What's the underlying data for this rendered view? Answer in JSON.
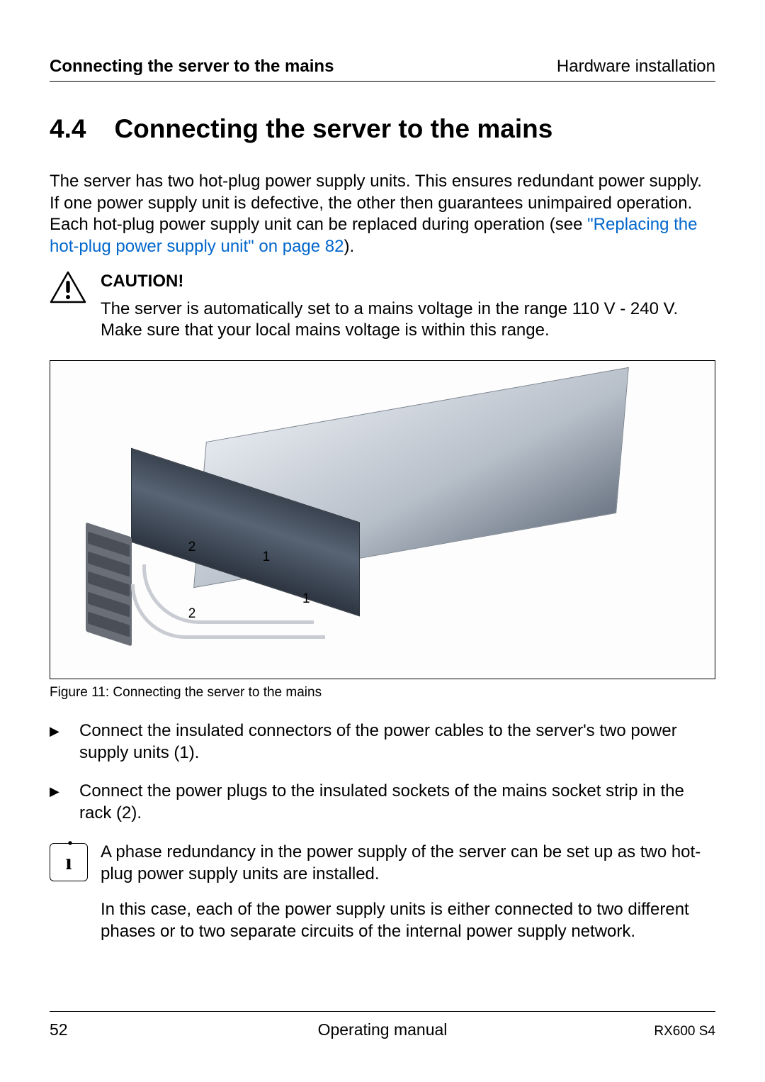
{
  "header": {
    "left": "Connecting the server to the mains",
    "right": "Hardware installation"
  },
  "section": {
    "number": "4.4",
    "title": "Connecting the server to the mains"
  },
  "intro": {
    "text_before_link": "The server has two hot-plug power supply units. This ensures redundant power supply. If one power supply unit is defective, the other then guarantees unimpaired operation. Each hot-plug power supply unit can be replaced during operation (see ",
    "link_text": "\"Replacing the hot-plug power supply unit\" on page 82",
    "text_after_link": ")."
  },
  "caution": {
    "title": "CAUTION!",
    "body": "The server is automatically set to a mains voltage in the range 110 V - 240 V. Make sure that your local mains voltage is within this range."
  },
  "figure": {
    "callouts": {
      "c2a": "2",
      "c1a": "1",
      "c1b": "1",
      "c2b": "2"
    },
    "caption": "Figure 11: Connecting the server to the mains"
  },
  "steps": [
    "Connect the insulated connectors of the power cables to the server's two power supply units (1).",
    "Connect the power plugs to the insulated sockets of the mains socket strip in the rack (2)."
  ],
  "info": {
    "p1": "A phase redundancy in the power supply of the server can be set up as two hot-plug power supply units are installed.",
    "p2": "In this case, each of the power supply units is either connected to two different phases or to two separate circuits of the internal power supply network."
  },
  "footer": {
    "page": "52",
    "center": "Operating manual",
    "right": "RX600 S4"
  },
  "bullet_glyph": "▶"
}
